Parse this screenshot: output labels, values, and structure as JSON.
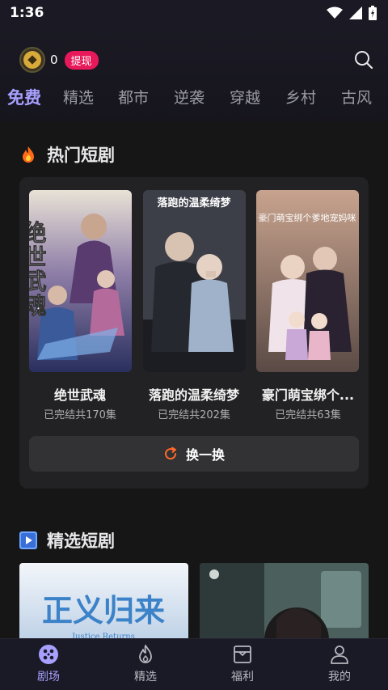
{
  "status": {
    "time": "1:36"
  },
  "header": {
    "coin_count": "0",
    "withdraw_label": "提现"
  },
  "tabs": [
    "免费",
    "精选",
    "都市",
    "逆袭",
    "穿越",
    "乡村",
    "古风"
  ],
  "hot_section": {
    "title": "热门短剧",
    "items": [
      {
        "title": "绝世武魂",
        "subtitle": "已完结共170集",
        "poster_text": "绝世武魂"
      },
      {
        "title": "落跑的温柔绮梦",
        "subtitle": "已完结共202集",
        "poster_text": "落跑的温柔绮梦"
      },
      {
        "title": "豪门萌宝绑个...",
        "subtitle": "已完结共63集",
        "poster_text": "豪门萌宝绑个爹地宠妈咪"
      }
    ],
    "refresh_label": "换一换"
  },
  "selected_section": {
    "title": "精选短剧",
    "items": [
      {
        "poster_text": "正义归来",
        "poster_subtext": "Justice Returns"
      },
      {
        "poster_text": ""
      }
    ]
  },
  "bottom_nav": [
    {
      "label": "剧场",
      "icon": "theater-icon"
    },
    {
      "label": "精选",
      "icon": "flame-icon"
    },
    {
      "label": "福利",
      "icon": "gift-box-icon"
    },
    {
      "label": "我的",
      "icon": "user-icon"
    }
  ],
  "colors": {
    "accent": "#a8a0ff",
    "badge": "#e8195a",
    "background": "#161616",
    "refresh_icon": "#ff6a2a"
  }
}
